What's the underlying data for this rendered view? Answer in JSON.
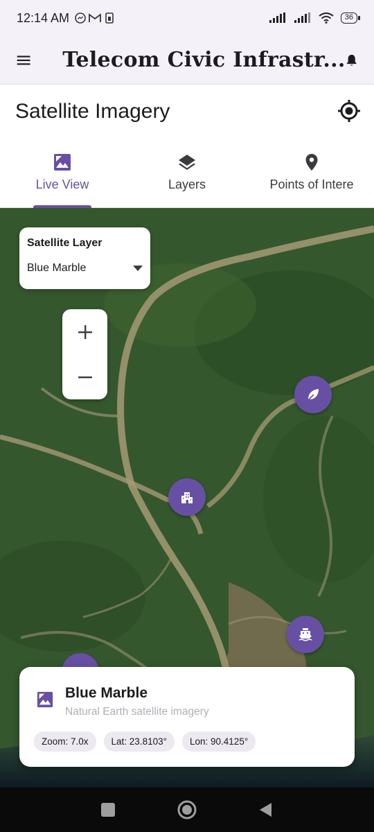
{
  "status_bar": {
    "time": "12:14 AM",
    "battery": "36"
  },
  "app_bar": {
    "title": "Telecom Civic Infrastr..."
  },
  "section": {
    "title": "Satellite Imagery"
  },
  "tabs": [
    {
      "label": "Live View",
      "icon": "image-icon",
      "active": true
    },
    {
      "label": "Layers",
      "icon": "layers-icon",
      "active": false
    },
    {
      "label": "Points of Intere",
      "icon": "location-pin-icon",
      "active": false
    }
  ],
  "layer_selector": {
    "title": "Satellite Layer",
    "selected": "Blue Marble"
  },
  "zoom_controls": {
    "plus": "+",
    "minus": "−"
  },
  "info_card": {
    "title": "Blue Marble",
    "subtitle": "Natural Earth satellite imagery",
    "chips": {
      "zoom": "Zoom: 7.0x",
      "lat": "Lat: 23.8103°",
      "lon": "Lon: 90.4125°"
    }
  },
  "colors": {
    "accent": "#6750a4",
    "map_green": "#34562d",
    "river_tan": "#a59a74"
  }
}
